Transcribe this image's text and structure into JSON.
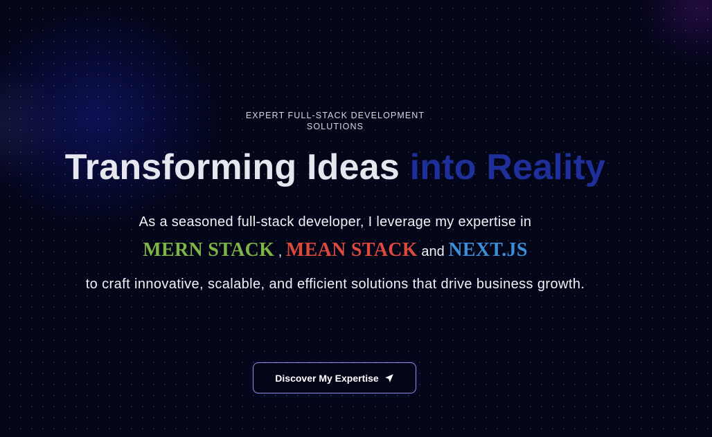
{
  "hero": {
    "eyebrow": "EXPERT FULL-STACK DEVELOPMENT SOLUTIONS",
    "headline_main": "Transforming Ideas ",
    "headline_accent": "into Reality",
    "lead": "As a seasoned full-stack developer, I leverage my expertise in",
    "stacks": {
      "first": "MERN STACK",
      "separator": ",",
      "second": "MEAN STACK",
      "conjunction": "and",
      "third": "NEXT.JS"
    },
    "tail": "to craft innovative, scalable, and efficient solutions that drive business growth.",
    "cta_label": "Discover My Expertise",
    "cta_icon": "send-icon"
  },
  "colors": {
    "background": "#030519",
    "headline": "#e6e6ee",
    "accent": "#1f2f9a",
    "mern": "#7fb544",
    "mean": "#dd4a3c",
    "next": "#3a8fd8",
    "cta_border": "#8f8fe6"
  }
}
